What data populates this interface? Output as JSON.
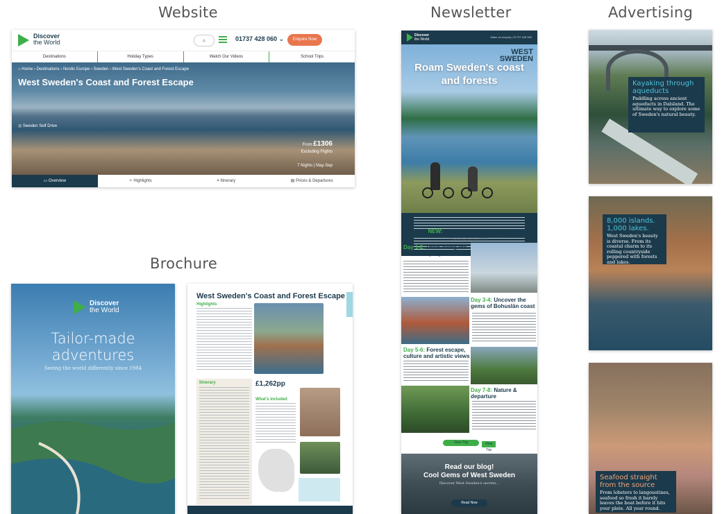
{
  "sections": {
    "website": "Website",
    "newsletter": "Newsletter",
    "advertising": "Advertising",
    "brochure": "Brochure"
  },
  "colors": {
    "navy": "#1b3a4b",
    "green": "#3fae49",
    "orange": "#e9764f",
    "teal": "#4fc3d9"
  },
  "website": {
    "logo_line1": "Discover",
    "logo_line2": "the World",
    "phone": "01737 428 060",
    "enquire": "Enquire Now",
    "nav": [
      "Destinations",
      "Holiday Types",
      "Watch Our Videos",
      "School Trips"
    ],
    "breadcrumb": "⌂ Home  ›  Destinations  ›  Nordic Europe  ›  Sweden  ›  West Sweden's Coast and Forest Escape",
    "title": "West Sweden's Coast and Forest Escape",
    "tags": "◎ Sweden     Self Drive",
    "price_from": "From",
    "price": "£1306",
    "price_note": "Excluding Flights",
    "duration": "7 Nights  |  May-Sep",
    "tabs": [
      "Overview",
      "Highlights",
      "Itinerary",
      "Prices & Departures"
    ]
  },
  "brochure": {
    "logo_line1": "Discover",
    "logo_line2": "the World",
    "headline_line1": "Tailor-made",
    "headline_line2": "adventures",
    "subline": "Seeing the world differently since 1984",
    "page_title": "West Sweden's Coast and Forest Escape",
    "highlights": "Highlights",
    "itinerary": "Itinerary",
    "price": "£1,262pp",
    "whats_included": "What's included"
  },
  "newsletter": {
    "logo_line1": "Discover",
    "logo_line2": "the World",
    "header_right": "Make an enquiry  |  01737 428 060",
    "ws_line1": "WEST",
    "ws_line2": "SWEDEN",
    "hero_line1": "Roam Sweden's coast",
    "hero_line2": "and forests",
    "new_label": "NEW:",
    "new_title": "Coast and Forest Escape",
    "subline": "7 nights   May-Sep   from £1,262*",
    "day1_label": "Day 1-2:",
    "day1_title": "Drive along the coast to Ljungskile",
    "day3_label": "Day 3-4:",
    "day3_title": "Uncover the gems of Bohuslän coast",
    "day5_label": "Day 5-6:",
    "day5_title": "Forest escape, culture and artistic views",
    "day7_label": "Day 7-8:",
    "day7_title": "Nature & departure",
    "view_trip": "View Trip",
    "view_trip2": "View Trip",
    "blog_line1": "Read our blog!",
    "blog_line2": "Cool Gems of West Sweden",
    "blog_line3": "Discover West Sweden's secrets...",
    "read_now": "Read Now"
  },
  "advertising": {
    "ad1_heading": "Kayaking through aqueducts",
    "ad1_body": "Paddling across ancient aqueducts in Dalsland. The ultimate way to explore some of Sweden's natural beauty.",
    "ad2_heading_line1": "8,000 islands.",
    "ad2_heading_line2": "1,000 lakes.",
    "ad2_body": "West Sweden's beauty is diverse. From its coastal charm to its rolling countryside peppered with forests and lakes.",
    "ad3_heading": "Seafood straight from the source",
    "ad3_body": "From lobsters to langoustines, seafood so fresh it barely leaves the boat before it hits your plate. All year round."
  }
}
